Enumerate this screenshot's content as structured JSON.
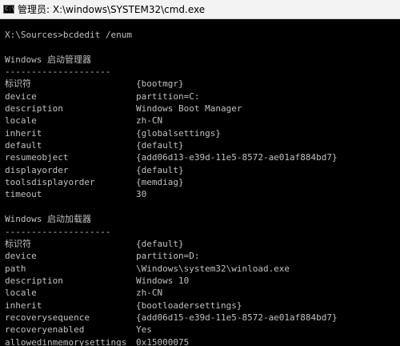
{
  "window": {
    "title": "管理员: X:\\windows\\SYSTEM32\\cmd.exe",
    "icon": "console-app-icon",
    "icon_glyph": "C:\\",
    "background": "#000000",
    "text_color": "#c0c0c0"
  },
  "console": {
    "command_line": "X:\\Sources>bcdedit /enum",
    "sections": [
      {
        "heading": "Windows 启动管理器",
        "separator": "--------------------",
        "entries": [
          {
            "key": "标识符",
            "value": "{bootmgr}"
          },
          {
            "key": "device",
            "value": "partition=C:"
          },
          {
            "key": "description",
            "value": "Windows Boot Manager"
          },
          {
            "key": "locale",
            "value": "zh-CN"
          },
          {
            "key": "inherit",
            "value": "{globalsettings}"
          },
          {
            "key": "default",
            "value": "{default}"
          },
          {
            "key": "resumeobject",
            "value": "{add06d13-e39d-11e5-8572-ae01af884bd7}"
          },
          {
            "key": "displayorder",
            "value": "{default}"
          },
          {
            "key": "toolsdisplayorder",
            "value": "{memdiag}"
          },
          {
            "key": "timeout",
            "value": "30"
          }
        ]
      },
      {
        "heading": "Windows 启动加载器",
        "separator": "--------------------",
        "entries": [
          {
            "key": "标识符",
            "value": "{default}"
          },
          {
            "key": "device",
            "value": "partition=D:"
          },
          {
            "key": "path",
            "value": "\\Windows\\system32\\winload.exe"
          },
          {
            "key": "description",
            "value": "Windows 10"
          },
          {
            "key": "locale",
            "value": "zh-CN"
          },
          {
            "key": "inherit",
            "value": "{bootloadersettings}"
          },
          {
            "key": "recoverysequence",
            "value": "{add06d15-e39d-11e5-8572-ae01af884bd7}"
          },
          {
            "key": "recoveryenabled",
            "value": "Yes"
          },
          {
            "key": "allowedinmemorysettings",
            "value": "0x15000075"
          }
        ]
      }
    ]
  }
}
